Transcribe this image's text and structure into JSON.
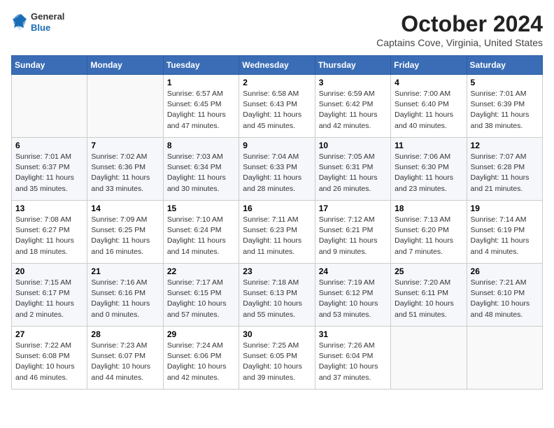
{
  "logo": {
    "general": "General",
    "blue": "Blue"
  },
  "header": {
    "month": "October 2024",
    "location": "Captains Cove, Virginia, United States"
  },
  "weekdays": [
    "Sunday",
    "Monday",
    "Tuesday",
    "Wednesday",
    "Thursday",
    "Friday",
    "Saturday"
  ],
  "weeks": [
    [
      {
        "day": null,
        "content": null
      },
      {
        "day": null,
        "content": null
      },
      {
        "day": "1",
        "content": "Sunrise: 6:57 AM\nSunset: 6:45 PM\nDaylight: 11 hours and 47 minutes."
      },
      {
        "day": "2",
        "content": "Sunrise: 6:58 AM\nSunset: 6:43 PM\nDaylight: 11 hours and 45 minutes."
      },
      {
        "day": "3",
        "content": "Sunrise: 6:59 AM\nSunset: 6:42 PM\nDaylight: 11 hours and 42 minutes."
      },
      {
        "day": "4",
        "content": "Sunrise: 7:00 AM\nSunset: 6:40 PM\nDaylight: 11 hours and 40 minutes."
      },
      {
        "day": "5",
        "content": "Sunrise: 7:01 AM\nSunset: 6:39 PM\nDaylight: 11 hours and 38 minutes."
      }
    ],
    [
      {
        "day": "6",
        "content": "Sunrise: 7:01 AM\nSunset: 6:37 PM\nDaylight: 11 hours and 35 minutes."
      },
      {
        "day": "7",
        "content": "Sunrise: 7:02 AM\nSunset: 6:36 PM\nDaylight: 11 hours and 33 minutes."
      },
      {
        "day": "8",
        "content": "Sunrise: 7:03 AM\nSunset: 6:34 PM\nDaylight: 11 hours and 30 minutes."
      },
      {
        "day": "9",
        "content": "Sunrise: 7:04 AM\nSunset: 6:33 PM\nDaylight: 11 hours and 28 minutes."
      },
      {
        "day": "10",
        "content": "Sunrise: 7:05 AM\nSunset: 6:31 PM\nDaylight: 11 hours and 26 minutes."
      },
      {
        "day": "11",
        "content": "Sunrise: 7:06 AM\nSunset: 6:30 PM\nDaylight: 11 hours and 23 minutes."
      },
      {
        "day": "12",
        "content": "Sunrise: 7:07 AM\nSunset: 6:28 PM\nDaylight: 11 hours and 21 minutes."
      }
    ],
    [
      {
        "day": "13",
        "content": "Sunrise: 7:08 AM\nSunset: 6:27 PM\nDaylight: 11 hours and 18 minutes."
      },
      {
        "day": "14",
        "content": "Sunrise: 7:09 AM\nSunset: 6:25 PM\nDaylight: 11 hours and 16 minutes."
      },
      {
        "day": "15",
        "content": "Sunrise: 7:10 AM\nSunset: 6:24 PM\nDaylight: 11 hours and 14 minutes."
      },
      {
        "day": "16",
        "content": "Sunrise: 7:11 AM\nSunset: 6:23 PM\nDaylight: 11 hours and 11 minutes."
      },
      {
        "day": "17",
        "content": "Sunrise: 7:12 AM\nSunset: 6:21 PM\nDaylight: 11 hours and 9 minutes."
      },
      {
        "day": "18",
        "content": "Sunrise: 7:13 AM\nSunset: 6:20 PM\nDaylight: 11 hours and 7 minutes."
      },
      {
        "day": "19",
        "content": "Sunrise: 7:14 AM\nSunset: 6:19 PM\nDaylight: 11 hours and 4 minutes."
      }
    ],
    [
      {
        "day": "20",
        "content": "Sunrise: 7:15 AM\nSunset: 6:17 PM\nDaylight: 11 hours and 2 minutes."
      },
      {
        "day": "21",
        "content": "Sunrise: 7:16 AM\nSunset: 6:16 PM\nDaylight: 11 hours and 0 minutes."
      },
      {
        "day": "22",
        "content": "Sunrise: 7:17 AM\nSunset: 6:15 PM\nDaylight: 10 hours and 57 minutes."
      },
      {
        "day": "23",
        "content": "Sunrise: 7:18 AM\nSunset: 6:13 PM\nDaylight: 10 hours and 55 minutes."
      },
      {
        "day": "24",
        "content": "Sunrise: 7:19 AM\nSunset: 6:12 PM\nDaylight: 10 hours and 53 minutes."
      },
      {
        "day": "25",
        "content": "Sunrise: 7:20 AM\nSunset: 6:11 PM\nDaylight: 10 hours and 51 minutes."
      },
      {
        "day": "26",
        "content": "Sunrise: 7:21 AM\nSunset: 6:10 PM\nDaylight: 10 hours and 48 minutes."
      }
    ],
    [
      {
        "day": "27",
        "content": "Sunrise: 7:22 AM\nSunset: 6:08 PM\nDaylight: 10 hours and 46 minutes."
      },
      {
        "day": "28",
        "content": "Sunrise: 7:23 AM\nSunset: 6:07 PM\nDaylight: 10 hours and 44 minutes."
      },
      {
        "day": "29",
        "content": "Sunrise: 7:24 AM\nSunset: 6:06 PM\nDaylight: 10 hours and 42 minutes."
      },
      {
        "day": "30",
        "content": "Sunrise: 7:25 AM\nSunset: 6:05 PM\nDaylight: 10 hours and 39 minutes."
      },
      {
        "day": "31",
        "content": "Sunrise: 7:26 AM\nSunset: 6:04 PM\nDaylight: 10 hours and 37 minutes."
      },
      {
        "day": null,
        "content": null
      },
      {
        "day": null,
        "content": null
      }
    ]
  ]
}
